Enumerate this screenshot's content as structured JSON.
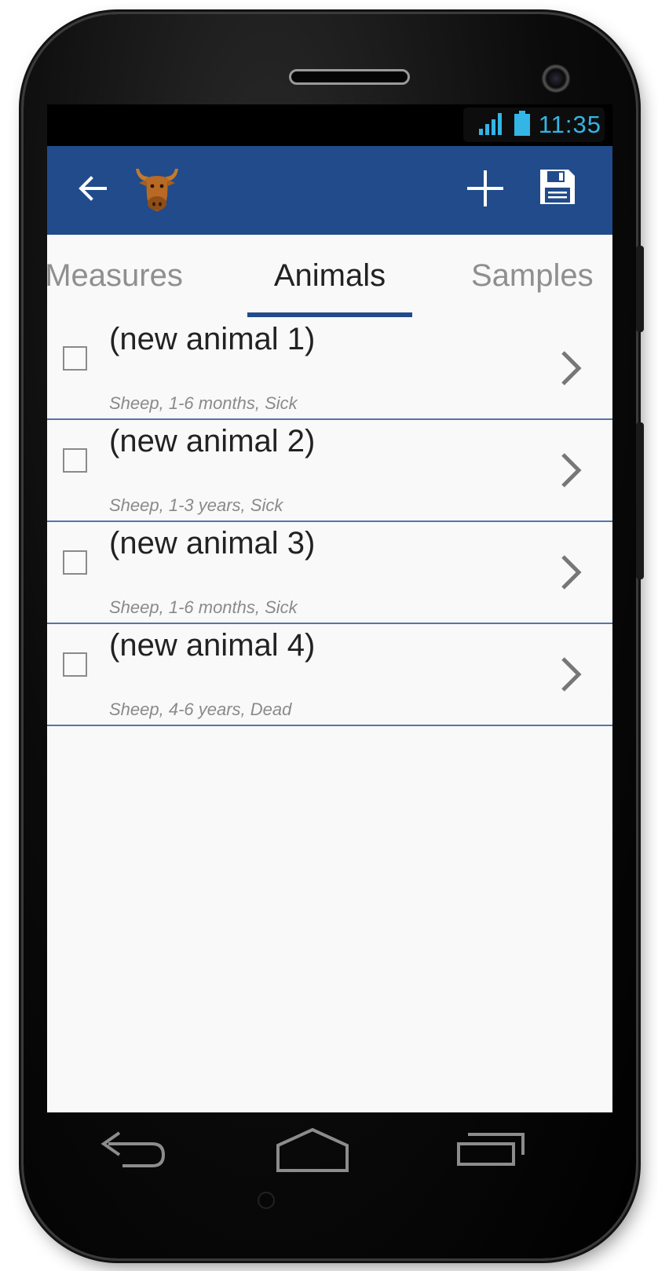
{
  "status": {
    "time": "11:35",
    "accent": "#33b5e5"
  },
  "actionbar": {
    "color": "#214b8a",
    "back_icon": "arrow-left-icon",
    "app_icon": "bull-head-icon",
    "add_icon": "plus-icon",
    "save_icon": "floppy-disk-icon"
  },
  "tabs": [
    {
      "label": "Measures",
      "selected": false
    },
    {
      "label": "Animals",
      "selected": true
    },
    {
      "label": "Samples",
      "selected": false
    }
  ],
  "animals": [
    {
      "name": "(new animal 1)",
      "details": "Sheep, 1-6 months, Sick",
      "checked": false
    },
    {
      "name": "(new animal 2)",
      "details": "Sheep, 1-3 years, Sick",
      "checked": false
    },
    {
      "name": "(new animal 3)",
      "details": "Sheep, 1-6 months, Sick",
      "checked": false
    },
    {
      "name": "(new animal 4)",
      "details": "Sheep, 4-6 years, Dead",
      "checked": false
    }
  ],
  "navbar": {
    "back_icon": "nav-back-icon",
    "home_icon": "nav-home-icon",
    "recents_icon": "nav-recents-icon"
  }
}
